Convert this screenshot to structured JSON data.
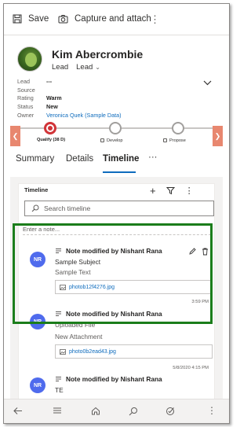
{
  "command_bar": {
    "save_label": "Save",
    "capture_label": "Capture and attach",
    "more_label": "⋮"
  },
  "record": {
    "name": "Kim Abercrombie",
    "entity_type": "Lead",
    "form_selector": "Lead",
    "fields": [
      {
        "label": "Lead Source",
        "value": "---"
      },
      {
        "label": "Rating",
        "value": "Warm"
      },
      {
        "label": "Status",
        "value": "New"
      },
      {
        "label": "Owner",
        "value": "Veronica Quek (Sample Data)"
      }
    ]
  },
  "process": {
    "stages": [
      {
        "label": "Qualify  (38 D)",
        "active": true
      },
      {
        "label": "Develop",
        "active": false
      },
      {
        "label": "Propose",
        "active": false
      }
    ]
  },
  "tabs": [
    {
      "label": "Summary"
    },
    {
      "label": "Details"
    },
    {
      "label": "Timeline"
    },
    {
      "label": "···"
    }
  ],
  "active_tab": "Timeline",
  "timeline": {
    "title": "Timeline",
    "search_placeholder": "Search timeline",
    "enter_note": "Enter a note...",
    "posts": [
      {
        "initials": "NR",
        "title": "Note modified by Nishant Rana",
        "subject": "Sample Subject",
        "body": "Sample Text",
        "attachment": "photob12f4276.jpg",
        "timestamp": "3:59 PM"
      },
      {
        "initials": "NR",
        "title": "Note modified by Nishant Rana",
        "subject": "Uploaded File",
        "body": "New Attachment",
        "attachment": "photo0b2ead43.jpg",
        "timestamp": "5/8/2020 4:15 PM"
      },
      {
        "initials": "NR",
        "title": "Note modified by Nishant Rana",
        "subject": "TE",
        "body": "",
        "attachment": "",
        "timestamp": ""
      }
    ]
  },
  "colors": {
    "accent": "#0f6cbd",
    "active_stage": "#d13438",
    "stage_arrow": "#e8876f",
    "highlight_border": "#1b7d1b",
    "avatar_bg": "#4f6bed"
  }
}
